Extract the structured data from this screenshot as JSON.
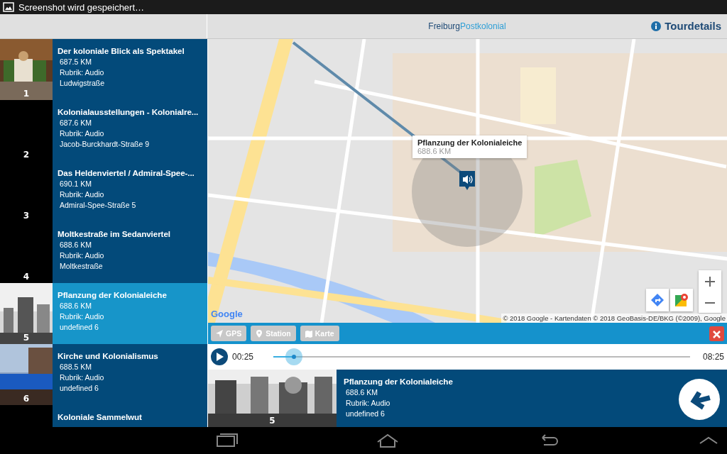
{
  "status_bar": {
    "notification": "Screenshot wird gespeichert…"
  },
  "header": {
    "title_part_1": "Freiburg",
    "title_part_2": "Postkolonial",
    "tour_details": "Tourdetails"
  },
  "stations": [
    {
      "number": "1",
      "title": "Der koloniale Blick als Spektakel",
      "distance": "687.5 KM",
      "category": "Rubrik: Audio",
      "address": "Ludwigstraße",
      "selected": false
    },
    {
      "number": "2",
      "title": "Kolonialausstellungen - Kolonialre...",
      "distance": "687.6 KM",
      "category": "Rubrik: Audio",
      "address": "Jacob-Burckhardt-Straße 9",
      "selected": false
    },
    {
      "number": "3",
      "title": "Das Heldenviertel / Admiral-Spee-...",
      "distance": "690.1 KM",
      "category": "Rubrik: Audio",
      "address": "Admiral-Spee-Straße 5",
      "selected": false
    },
    {
      "number": "4",
      "title": "Moltkestraße im Sedanviertel",
      "distance": "688.6 KM",
      "category": "Rubrik: Audio",
      "address": "Moltkestraße",
      "selected": false
    },
    {
      "number": "5",
      "title": "Pflanzung der Kolonialeiche",
      "distance": "688.6 KM",
      "category": "Rubrik: Audio",
      "address": "undefined 6",
      "selected": true
    },
    {
      "number": "6",
      "title": "Kirche und Kolonialismus",
      "distance": "688.5 KM",
      "category": "Rubrik: Audio",
      "address": "undefined 6",
      "selected": false
    },
    {
      "title": "Koloniale Sammelwut",
      "selected": false
    }
  ],
  "map": {
    "kind": "picture",
    "info_window": {
      "title": "Pflanzung der Kolonialeiche",
      "distance": "688.6 KM"
    },
    "logo": "Google",
    "attribution": "© 2018 Google - Kartendaten © 2018 GeoBasis-DE/BKG (©2009), Google"
  },
  "toolbar": {
    "buttons": [
      "GPS",
      "Station",
      "Karte"
    ]
  },
  "player": {
    "elapsed": "00:25",
    "level": 0.05,
    "duration": "08:25"
  },
  "now_playing": {
    "number": "5",
    "title": "Pflanzung der Kolonialeiche",
    "distance": "688.6 KM",
    "category": "Rubrik: Audio",
    "address": "undefined 6"
  }
}
